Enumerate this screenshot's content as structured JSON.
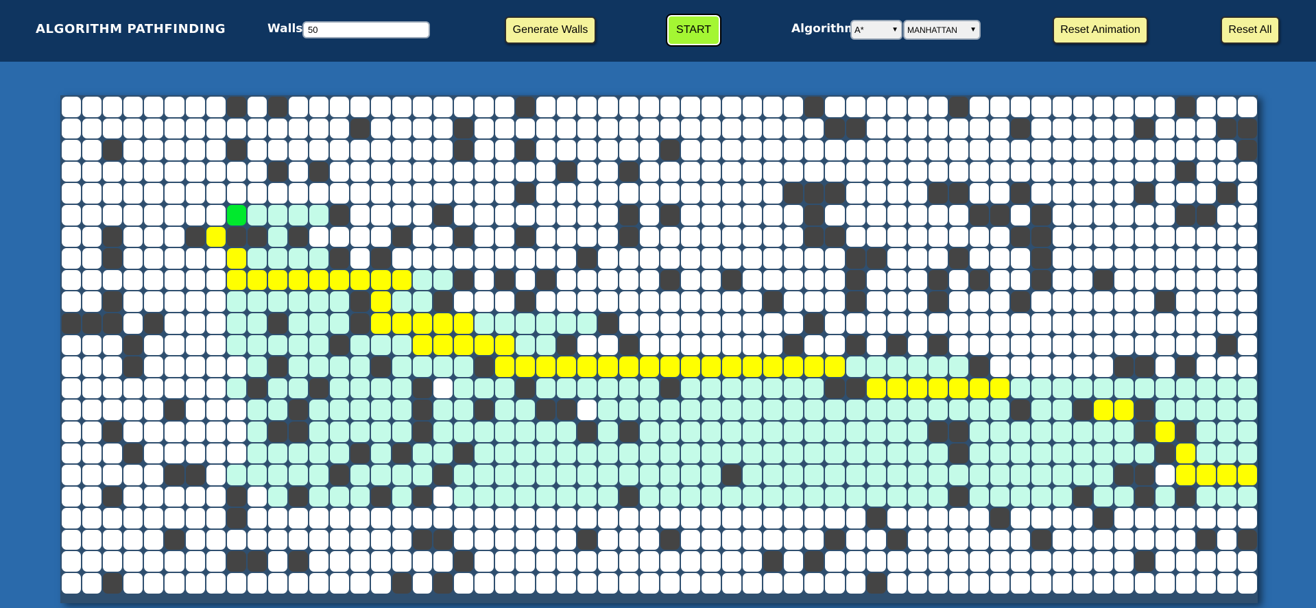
{
  "app": {
    "title": "ALGORITHM PATHFINDING"
  },
  "controls": {
    "walls_label": "Walls:",
    "walls_value": "50",
    "generate_label": "Generate Walls",
    "start_label": "START",
    "algorithm_label": "Algorithm:",
    "algorithm_selected": "A*",
    "heuristic_selected": "MANHATTAN",
    "reset_animation_label": "Reset Animation",
    "reset_all_label": "Reset All"
  },
  "colors": {
    "empty": "#ffffff",
    "wall": "#444444",
    "visited": "#c4fbe8",
    "path": "#ffff00",
    "start": "#00e92d",
    "end": "#ff3a3a",
    "start_button": "#a4f633",
    "button": "#f5f39b"
  },
  "grid": {
    "cols": 58,
    "rows": 23,
    "legend": {
      ".": "empty",
      "#": "wall",
      "v": "visited",
      "p": "path",
      "S": "start",
      "E": "end"
    },
    "cells": [
      "........#.#...........#.............#......#..........#......#..",
      "..............#....#.................##.......#.....#...##.",
      "..#.....#..........#..#......#...........................#.....#..#.",
      "..........#.#...........#..#......................#.....",
      "...........................#..................###.....##..#.....#...#",
      "........................................................"
    ]
  }
}
